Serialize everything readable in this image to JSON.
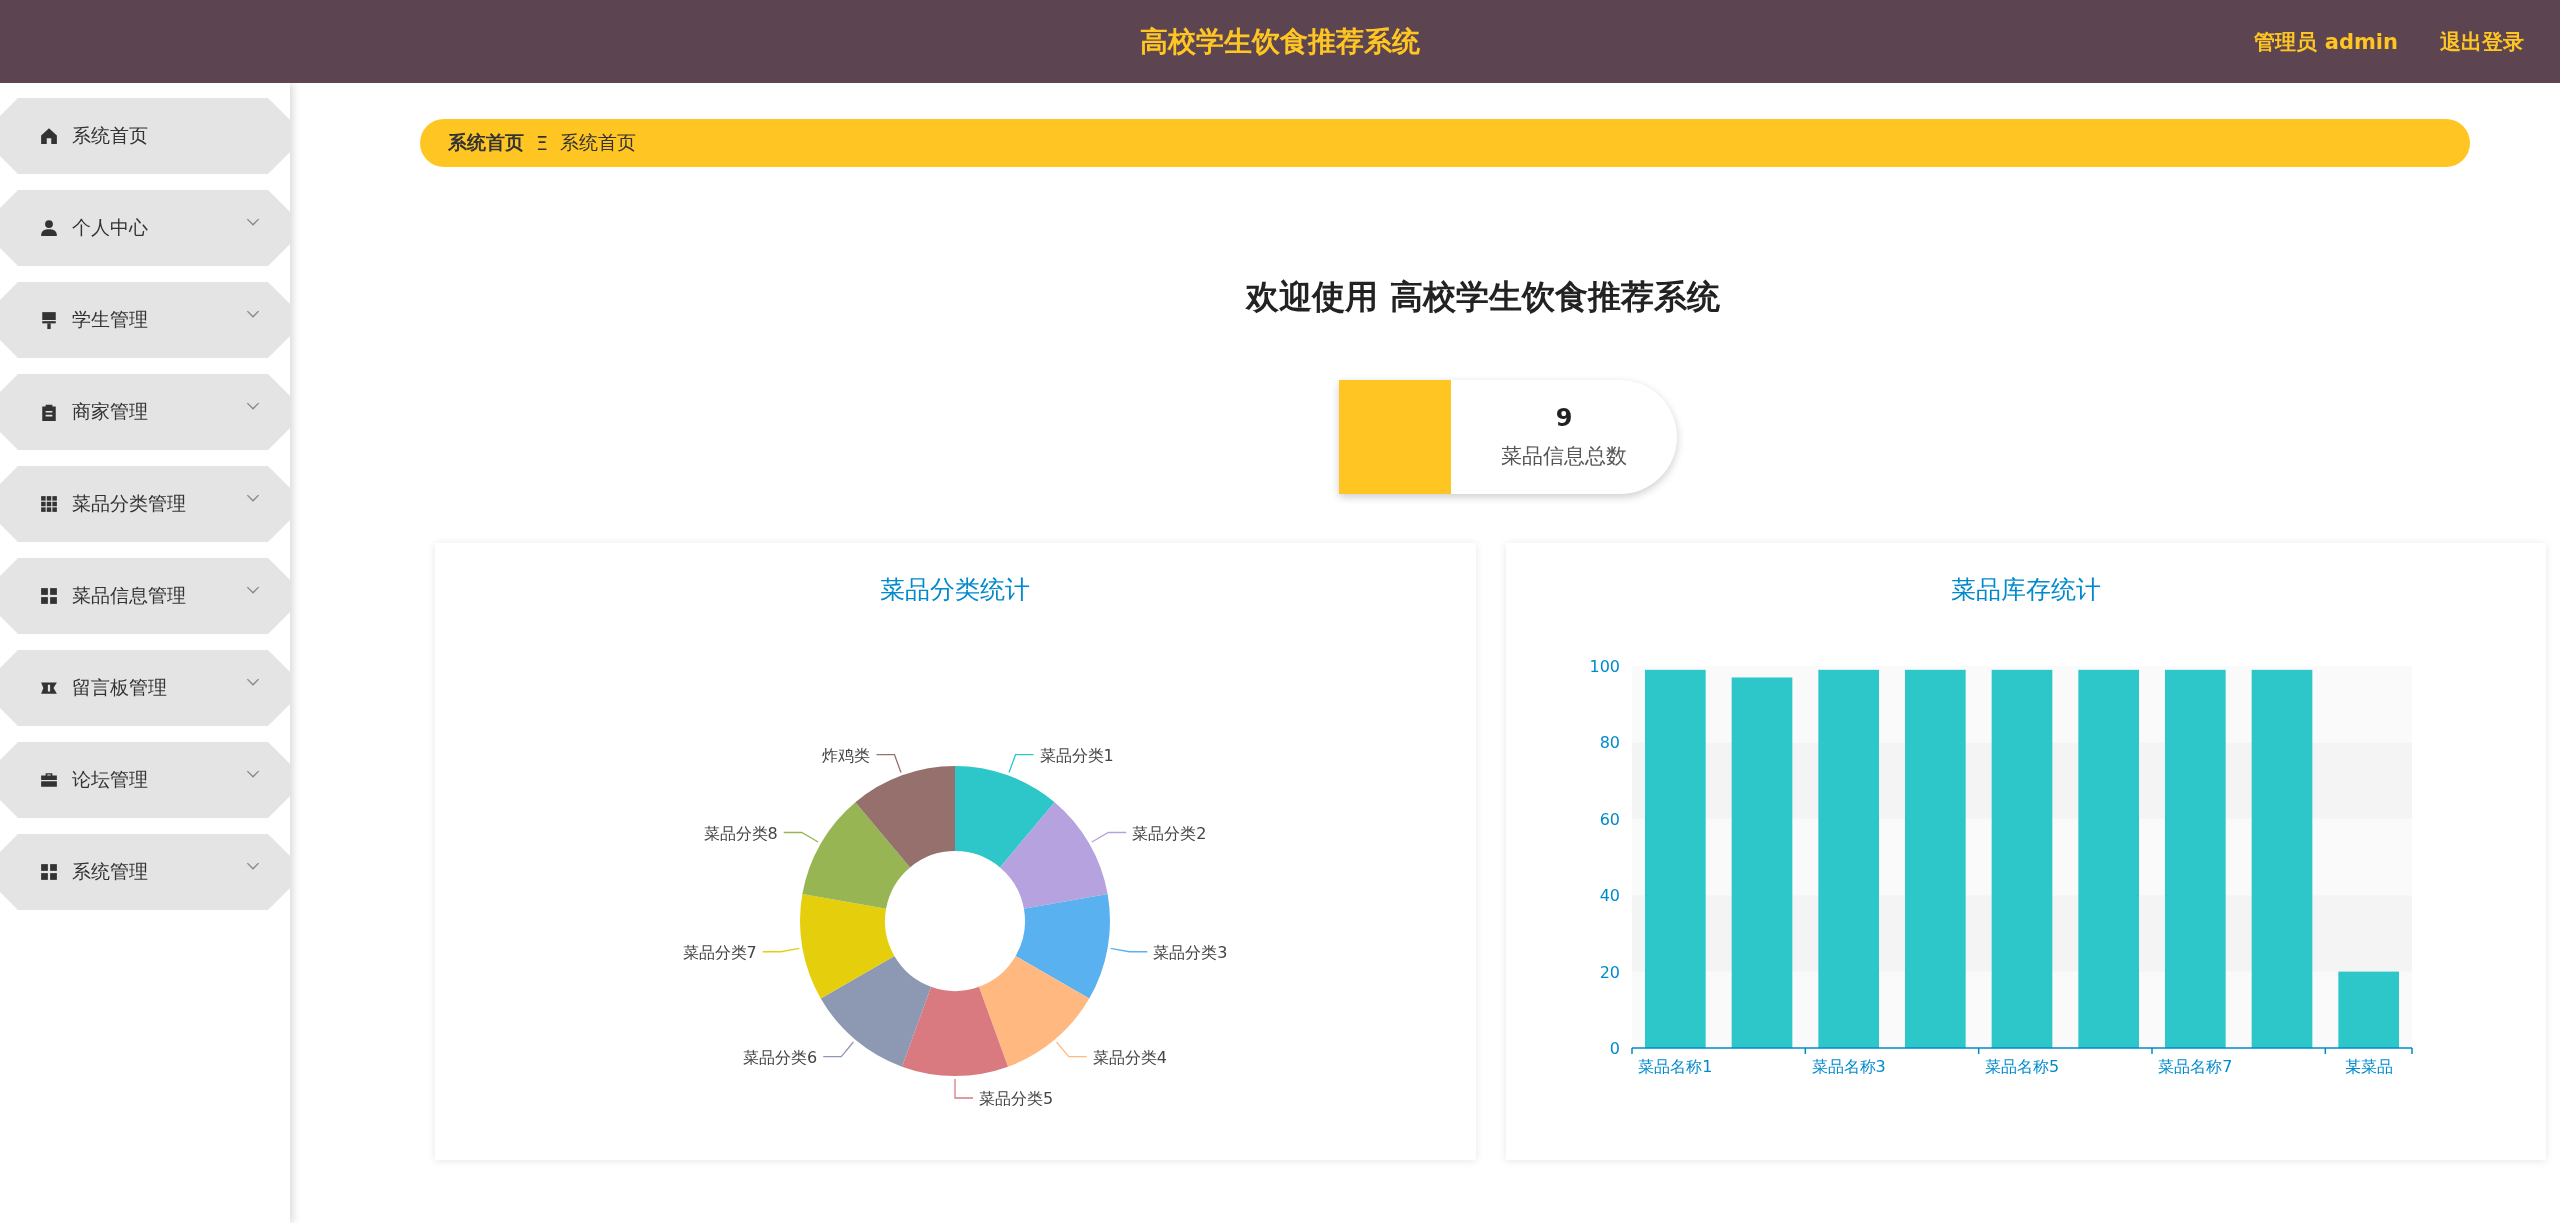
{
  "header": {
    "title": "高校学生饮食推荐系统",
    "user": "管理员 admin",
    "logout": "退出登录"
  },
  "sidebar": {
    "items": [
      {
        "label": "系统首页",
        "kind": "home",
        "expandable": false
      },
      {
        "label": "个人中心",
        "kind": "user",
        "expandable": true
      },
      {
        "label": "学生管理",
        "kind": "brush",
        "expandable": true
      },
      {
        "label": "商家管理",
        "kind": "clipboard",
        "expandable": true
      },
      {
        "label": "菜品分类管理",
        "kind": "grid9",
        "expandable": true
      },
      {
        "label": "菜品信息管理",
        "kind": "grid4",
        "expandable": true
      },
      {
        "label": "留言板管理",
        "kind": "ticket",
        "expandable": true
      },
      {
        "label": "论坛管理",
        "kind": "briefcase",
        "expandable": true
      },
      {
        "label": "系统管理",
        "kind": "grid4",
        "expandable": true
      }
    ]
  },
  "breadcrumb": {
    "separator": "Ξ",
    "items": [
      {
        "label": "系统首页",
        "current": false
      },
      {
        "label": "系统首页",
        "current": true
      }
    ]
  },
  "welcome": "欢迎使用 高校学生饮食推荐系统",
  "stats": [
    {
      "value": "9",
      "label": "菜品信息总数"
    }
  ],
  "charts": [
    {
      "kind": "donut",
      "title": "菜品分类统计",
      "slices": [
        {
          "label": "菜品分类1",
          "color": "#2ec7c9"
        },
        {
          "label": "菜品分类2",
          "color": "#b6a2de"
        },
        {
          "label": "菜品分类3",
          "color": "#5ab1ef"
        },
        {
          "label": "菜品分类4",
          "color": "#ffb980"
        },
        {
          "label": "菜品分类5",
          "color": "#d87a80"
        },
        {
          "label": "菜品分类6",
          "color": "#8d98b3"
        },
        {
          "label": "菜品分类7",
          "color": "#e5cf0d"
        },
        {
          "label": "菜品分类8",
          "color": "#97b552"
        },
        {
          "label": "炸鸡类",
          "color": "#95706d"
        }
      ]
    },
    {
      "kind": "bar",
      "title": "菜品库存统计",
      "chart_data": {
        "type": "bar",
        "categories": [
          "菜品名称1",
          null,
          "菜品名称3",
          null,
          "菜品名称5",
          null,
          "菜品名称7",
          null,
          "某菜品"
        ],
        "series": [
          {
            "color": "#2ec7c9",
            "values": [
              99,
              97,
              99,
              99,
              99,
              99,
              99,
              99,
              20
            ]
          }
        ],
        "ylim": [
          0,
          100
        ],
        "yticks": [
          0,
          20,
          40,
          60,
          80,
          100
        ]
      }
    }
  ]
}
